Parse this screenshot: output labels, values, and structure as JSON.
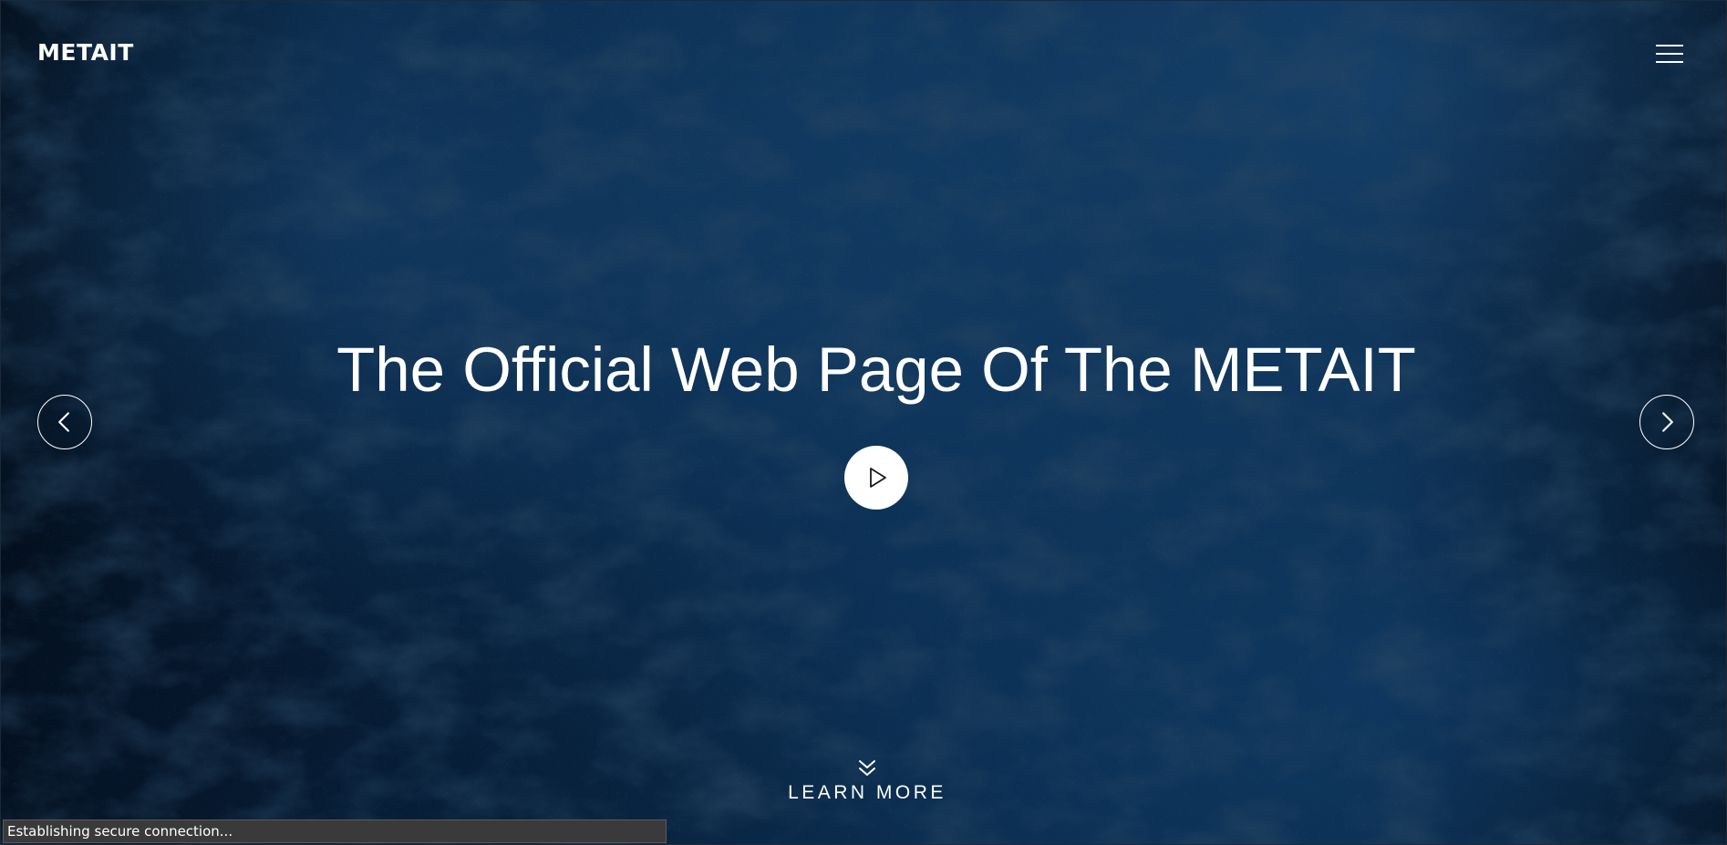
{
  "header": {
    "logo_text": "METAIT",
    "menu_icon": "hamburger-menu-icon"
  },
  "hero": {
    "headline": "The Official Web Page Of The METAIT",
    "prev_icon": "chevron-left-icon",
    "next_icon": "chevron-right-icon",
    "play_icon": "play-icon",
    "learn_more_label": "LEARN MORE",
    "learn_more_icon": "double-chevron-down-icon"
  },
  "status_bar": {
    "text": "Establishing secure connection..."
  },
  "colors": {
    "background": "#0b2f52",
    "text": "#ffffff",
    "status_bar_bg": "#3a3a3a"
  }
}
